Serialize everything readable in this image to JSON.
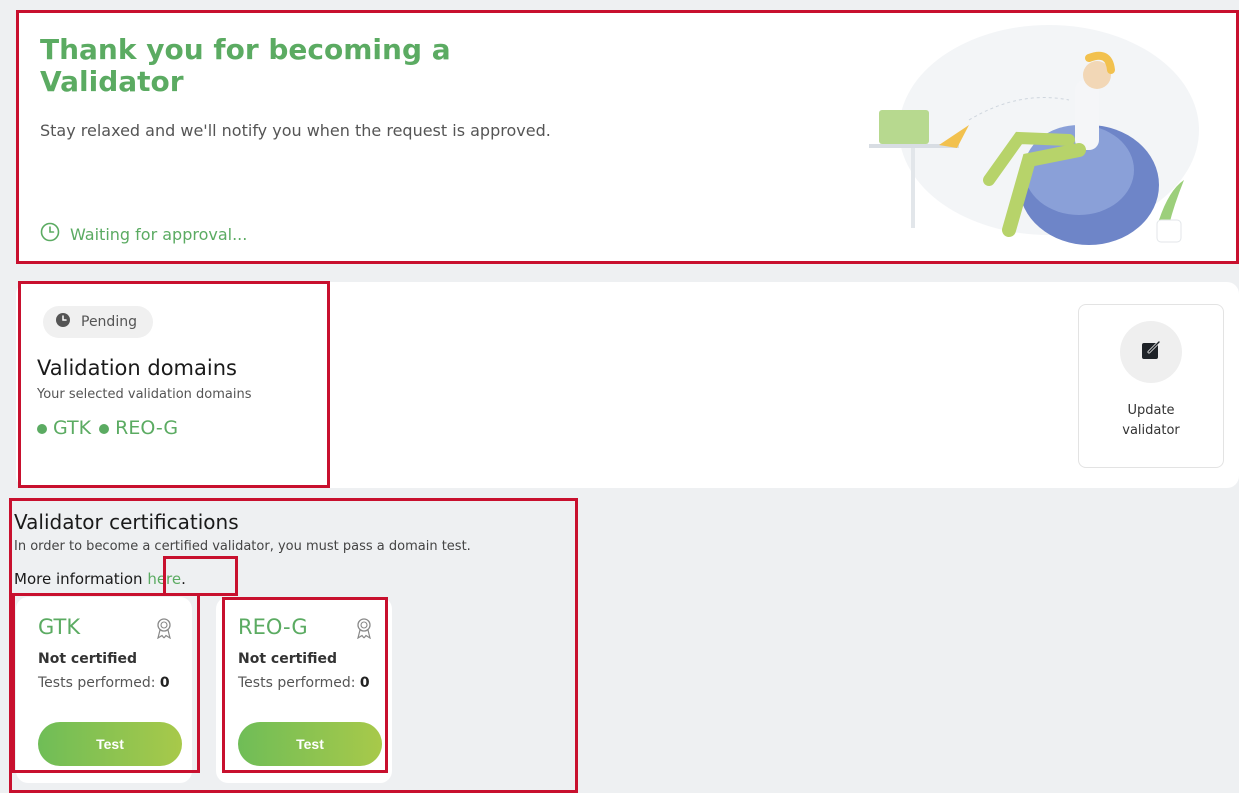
{
  "banner": {
    "title": "Thank you for becoming a Validator",
    "description": "Stay relaxed and we'll notify you when the request is approved.",
    "waiting_text": "Waiting for approval..."
  },
  "domains_card": {
    "pending_label": "Pending",
    "title": "Validation domains",
    "subtitle": "Your selected validation domains",
    "domains": [
      "GTK",
      "REO-G"
    ],
    "update_label": "Update validator"
  },
  "certifications": {
    "title": "Validator certifications",
    "subtitle": "In order to become a certified validator, you must pass a domain test.",
    "more_info_prefix": "More information",
    "more_info_link": "here",
    "more_info_suffix": ".",
    "cards": [
      {
        "name": "GTK",
        "status": "Not certified",
        "tests_label": "Tests performed:",
        "tests_count": "0",
        "button": "Test"
      },
      {
        "name": "REO-G",
        "status": "Not certified",
        "tests_label": "Tests performed:",
        "tests_count": "0",
        "button": "Test"
      }
    ]
  },
  "colors": {
    "accent": "#5bab62",
    "annotation": "#c8102e"
  }
}
